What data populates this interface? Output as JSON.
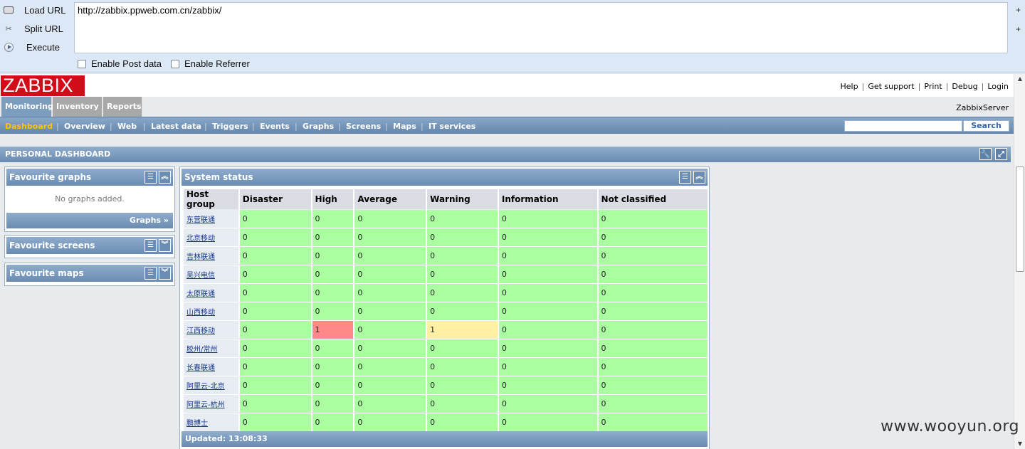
{
  "hackbar": {
    "load_url": "Load URL",
    "split_url": "Split URL",
    "execute": "Execute",
    "url": "http://zabbix.ppweb.com.cn/zabbix/",
    "enable_post": "Enable Post data",
    "enable_referrer": "Enable Referrer",
    "plus": "+"
  },
  "header": {
    "logo": "ZABBIX",
    "links": [
      "Help",
      "Get support",
      "Print",
      "Debug",
      "Login"
    ],
    "server": "ZabbixServer"
  },
  "main_menu": [
    "Monitoring",
    "Inventory",
    "Reports"
  ],
  "sub_menu": [
    "Dashboard",
    "Overview",
    "Web",
    "Latest data",
    "Triggers",
    "Events",
    "Graphs",
    "Screens",
    "Maps",
    "IT services"
  ],
  "search": {
    "button": "Search",
    "value": ""
  },
  "dashboard": {
    "title": "PERSONAL DASHBOARD"
  },
  "fav_graphs": {
    "title": "Favourite graphs",
    "empty": "No graphs added.",
    "footer": "Graphs »"
  },
  "fav_screens": {
    "title": "Favourite screens"
  },
  "fav_maps": {
    "title": "Favourite maps"
  },
  "system_status": {
    "title": "System status",
    "columns": [
      "Host group",
      "Disaster",
      "High",
      "Average",
      "Warning",
      "Information",
      "Not classified"
    ],
    "rows": [
      {
        "group": "东营联通",
        "values": [
          "0",
          "0",
          "0",
          "0",
          "0",
          "0"
        ]
      },
      {
        "group": "北京移动",
        "values": [
          "0",
          "0",
          "0",
          "0",
          "0",
          "0"
        ]
      },
      {
        "group": "吉林联通",
        "values": [
          "0",
          "0",
          "0",
          "0",
          "0",
          "0"
        ]
      },
      {
        "group": "吴兴电信",
        "values": [
          "0",
          "0",
          "0",
          "0",
          "0",
          "0"
        ]
      },
      {
        "group": "太原联通",
        "values": [
          "0",
          "0",
          "0",
          "0",
          "0",
          "0"
        ]
      },
      {
        "group": "山西移动",
        "values": [
          "0",
          "0",
          "0",
          "0",
          "0",
          "0"
        ]
      },
      {
        "group": "江西移动",
        "values": [
          "0",
          "1",
          "0",
          "1",
          "0",
          "0"
        ]
      },
      {
        "group": "胶州/常州",
        "values": [
          "0",
          "0",
          "0",
          "0",
          "0",
          "0"
        ]
      },
      {
        "group": "长春联通",
        "values": [
          "0",
          "0",
          "0",
          "0",
          "0",
          "0"
        ]
      },
      {
        "group": "阿里云-北京",
        "values": [
          "0",
          "0",
          "0",
          "0",
          "0",
          "0"
        ]
      },
      {
        "group": "阿里云-杭州",
        "values": [
          "0",
          "0",
          "0",
          "0",
          "0",
          "0"
        ]
      },
      {
        "group": "鹏博士",
        "values": [
          "0",
          "0",
          "0",
          "0",
          "0",
          "0"
        ]
      }
    ],
    "updated": "Updated: 13:08:33"
  },
  "watermark": "www.wooyun.org"
}
